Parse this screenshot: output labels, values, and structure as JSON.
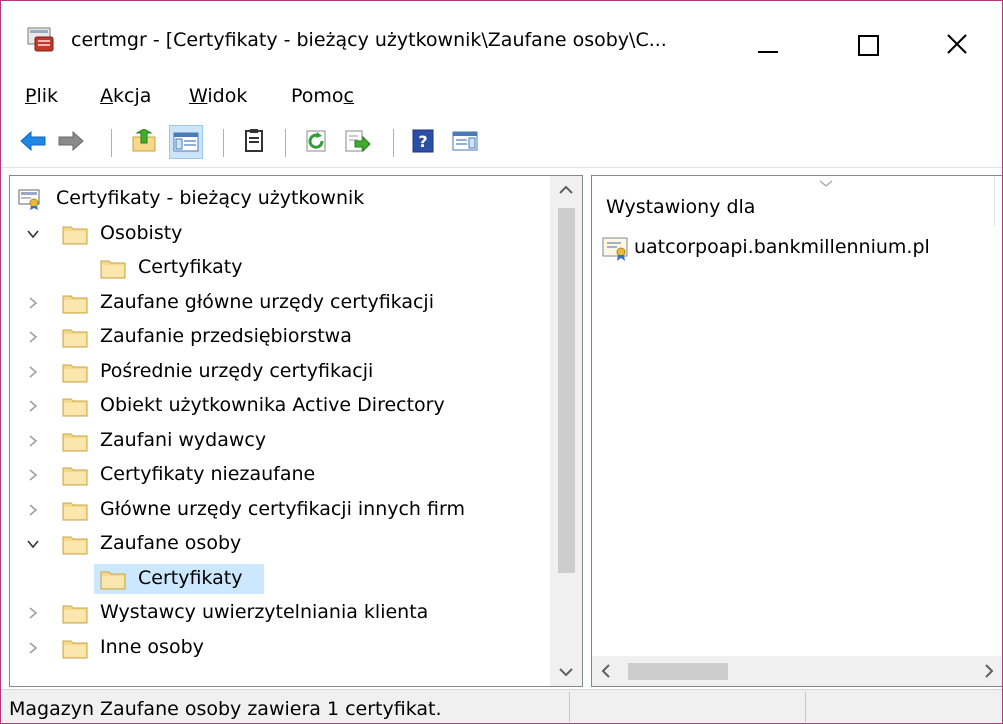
{
  "window": {
    "title": "certmgr - [Certyfikaty - bieżący użytkownik\\Zaufane osoby\\C...",
    "icons": {
      "app": "certmgr-icon",
      "minimize": "minimize-icon",
      "maximize": "maximize-icon",
      "close": "close-icon"
    }
  },
  "menu": {
    "items": [
      {
        "first": "P",
        "rest": "lik"
      },
      {
        "first": "A",
        "rest": "kcja"
      },
      {
        "first": "W",
        "rest": "idok"
      },
      {
        "pre": "Pomo",
        "ul": "c"
      }
    ]
  },
  "toolbar": {
    "icons": [
      "back-arrow-icon",
      "forward-arrow-icon",
      "up-folder-icon",
      "show-hide-tree-icon",
      "clipboard-icon",
      "refresh-icon",
      "export-list-icon",
      "help-icon",
      "properties-pane-icon"
    ]
  },
  "tree": {
    "items": [
      {
        "label": "Certyfikaty - bieżący użytkownik",
        "expand": "none",
        "indent": 0,
        "icon": "certificate-store-icon"
      },
      {
        "label": "Osobisty",
        "expand": "expanded",
        "indent": 0,
        "icon": "folder-icon"
      },
      {
        "label": "Certyfikaty",
        "expand": "none",
        "indent": 1,
        "icon": "folder-icon"
      },
      {
        "label": "Zaufane główne urzędy certyfikacji",
        "expand": "collapsed",
        "indent": 0,
        "icon": "folder-icon"
      },
      {
        "label": "Zaufanie przedsiębiorstwa",
        "expand": "collapsed",
        "indent": 0,
        "icon": "folder-icon"
      },
      {
        "label": "Pośrednie urzędy certyfikacji",
        "expand": "collapsed",
        "indent": 0,
        "icon": "folder-icon"
      },
      {
        "label": "Obiekt użytkownika Active Directory",
        "expand": "collapsed",
        "indent": 0,
        "icon": "folder-icon"
      },
      {
        "label": "Zaufani wydawcy",
        "expand": "collapsed",
        "indent": 0,
        "icon": "folder-icon"
      },
      {
        "label": "Certyfikaty niezaufane",
        "expand": "collapsed",
        "indent": 0,
        "icon": "folder-icon"
      },
      {
        "label": "Główne urzędy certyfikacji innych firm",
        "expand": "collapsed",
        "indent": 0,
        "icon": "folder-icon"
      },
      {
        "label": "Zaufane osoby",
        "expand": "expanded",
        "indent": 0,
        "icon": "folder-icon"
      },
      {
        "label": "Certyfikaty",
        "expand": "none",
        "indent": 1,
        "icon": "folder-icon",
        "selected": true
      },
      {
        "label": "Wystawcy uwierzytelniania klienta",
        "expand": "collapsed",
        "indent": 0,
        "icon": "folder-icon"
      },
      {
        "label": "Inne osoby",
        "expand": "collapsed",
        "indent": 0,
        "icon": "folder-icon"
      }
    ]
  },
  "list": {
    "column_header": "Wystawiony dla",
    "rows": [
      {
        "label": "uatcorpoapi.bankmillennium.pl",
        "icon": "certificate-icon"
      }
    ]
  },
  "status": {
    "text": "Magazyn Zaufane osoby zawiera 1 certyfikat."
  },
  "colors": {
    "window_border": "#b5397c",
    "selection": "#cce8ff",
    "back_arrow": "#1e88e5",
    "forward_arrow": "#707070",
    "folder": "#f6d98a"
  }
}
